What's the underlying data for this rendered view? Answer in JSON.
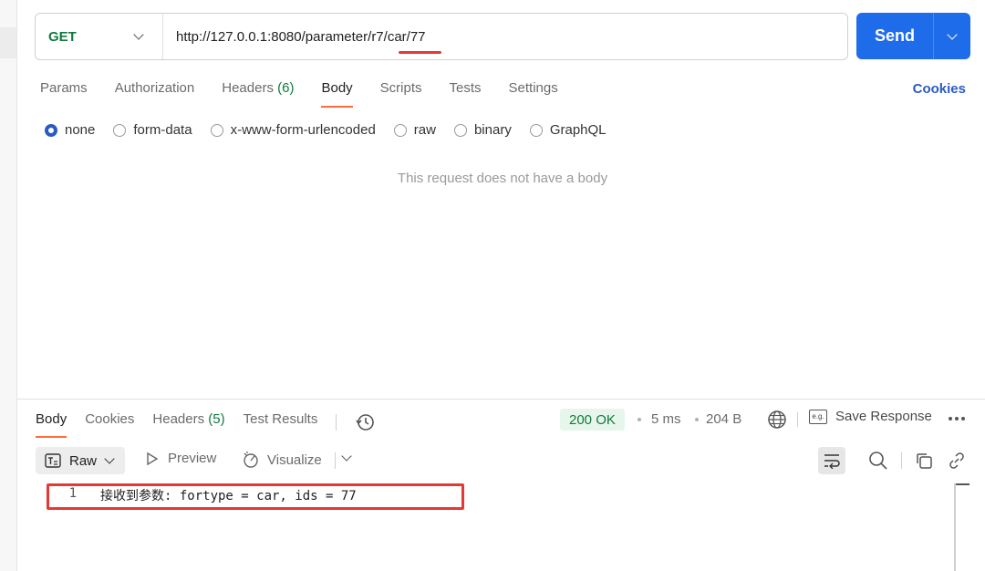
{
  "request": {
    "method": "GET",
    "url": "http://127.0.0.1:8080/parameter/r7/car/77",
    "send_label": "Send"
  },
  "req_tabs": {
    "params": "Params",
    "authorization": "Authorization",
    "headers": "Headers",
    "headers_count": "(6)",
    "body": "Body",
    "scripts": "Scripts",
    "tests": "Tests",
    "settings": "Settings",
    "cookies": "Cookies"
  },
  "body_options": {
    "none": "none",
    "form_data": "form-data",
    "urlencoded": "x-www-form-urlencoded",
    "raw": "raw",
    "binary": "binary",
    "graphql": "GraphQL",
    "selected": "none",
    "empty_message": "This request does not have a body"
  },
  "response": {
    "tabs": {
      "body": "Body",
      "cookies": "Cookies",
      "headers": "Headers",
      "headers_count": "(5)",
      "test_results": "Test Results"
    },
    "status": "200 OK",
    "time": "5 ms",
    "size": "204 B",
    "save_label": "Save Response",
    "format": "Raw",
    "preview": "Preview",
    "visualize": "Visualize",
    "lines": [
      {
        "num": "1",
        "text": "接收到参数: fortype = car, ids = 77"
      }
    ]
  },
  "colors": {
    "accent": "#1e6cea",
    "method_get": "#0f7a3f",
    "tab_active": "#ff6c37",
    "link": "#2a5bc2",
    "highlight": "#e53935"
  }
}
